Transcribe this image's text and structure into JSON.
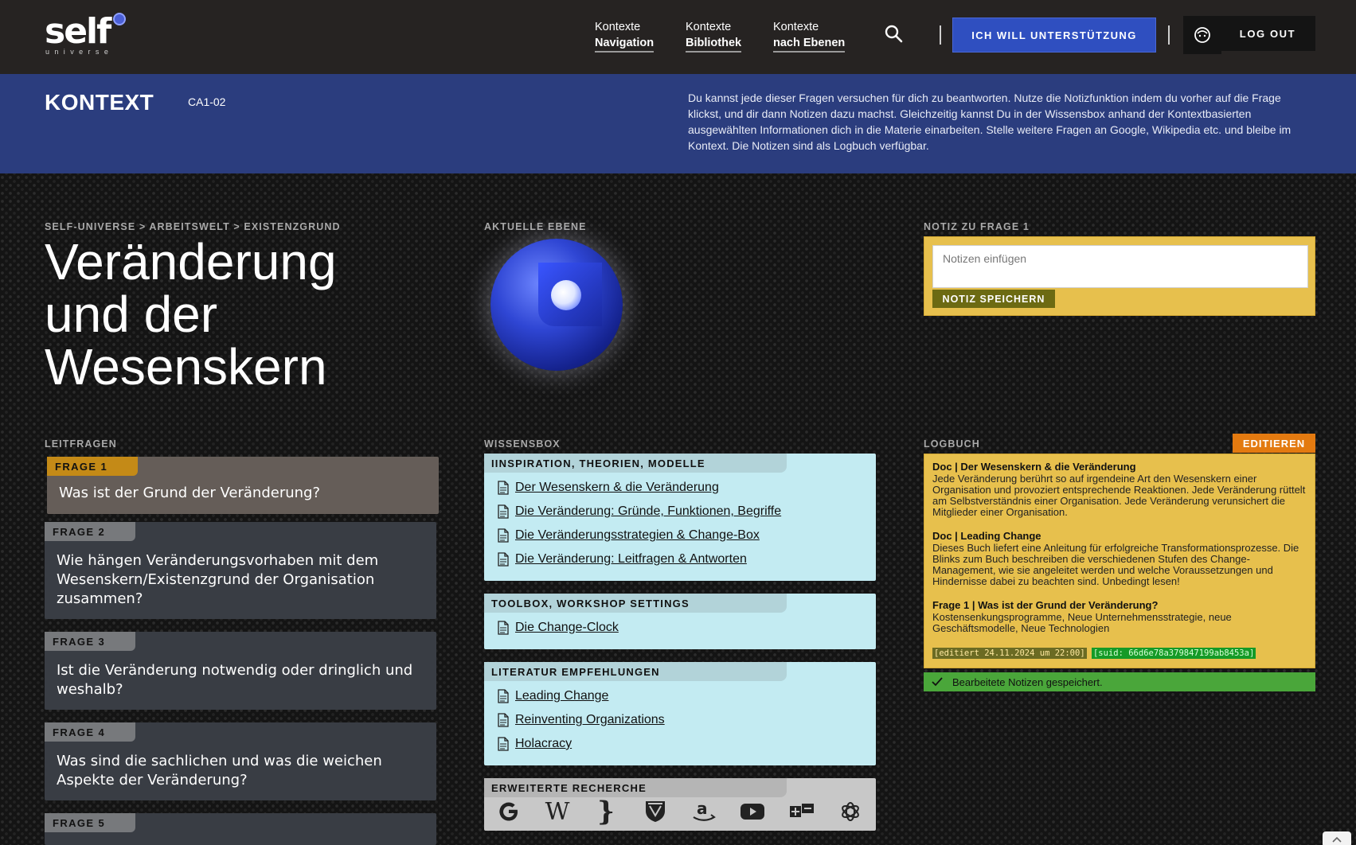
{
  "header": {
    "logo_word": "self",
    "logo_sub": "universe",
    "nav": [
      {
        "line1": "Kontexte",
        "line2": "Navigation"
      },
      {
        "line1": "Kontexte",
        "line2": "Bibliothek"
      },
      {
        "line1": "Kontexte",
        "line2": "nach Ebenen"
      }
    ],
    "support_label": "ICH WILL UNTERSTÜTZUNG",
    "logout_label": "LOG OUT"
  },
  "context": {
    "title": "KONTEXT",
    "code": "CA1-02",
    "description": "Du kannst jede dieser Fragen versuchen für dich zu beantworten. Nutze die Notizfunktion indem du vorher auf die Frage klickst, und dir dann Notizen dazu machst. Gleichzeitig kannst Du in der Wissensbox anhand der Kontextbasierten ausgewählten Informationen dich in die Materie einarbeiten. Stelle weitere Fragen an Google, Wikipedia etc. und bleibe im Kontext. Die Notizen sind als Logbuch verfügbar."
  },
  "breadcrumb": "SELF-UNIVERSE > ARBEITSWELT > EXISTENZGRUND",
  "title_lines": [
    "Veränderung",
    "und der",
    "Wesenskern"
  ],
  "level": {
    "label": "AKTUELLE EBENE"
  },
  "note": {
    "label": "NOTIZ ZU FRAGE 1",
    "placeholder": "Notizen einfügen",
    "save_label": "NOTIZ SPEICHERN"
  },
  "questions": {
    "label": "LEITFRAGEN",
    "items": [
      {
        "tag": "FRAGE 1",
        "text": "Was ist der Grund der Veränderung?"
      },
      {
        "tag": "FRAGE 2",
        "text": "Wie hängen Veränderungsvorhaben mit dem Wesenskern/Existenzgrund der Organisation zusammen?"
      },
      {
        "tag": "FRAGE 3",
        "text": "Ist die Veränderung notwendig oder dringlich und weshalb?"
      },
      {
        "tag": "FRAGE 4",
        "text": "Was sind die sachlichen und was die weichen Aspekte der Veränderung?"
      },
      {
        "tag": "FRAGE 5",
        "text": ""
      }
    ]
  },
  "wissensbox": {
    "label": "WISSENSBOX",
    "sections": [
      {
        "title": "IINSPIRATION, THEORIEN, MODELLE",
        "links": [
          "Der Wesenskern & die Veränderung",
          "Die Veränderung: Gründe, Funktionen, Begriffe",
          "Die Veränderungsstrategien & Change-Box",
          "Die Veränderung: Leitfragen & Antworten"
        ]
      },
      {
        "title": "TOOLBOX, WORKSHOP SETTINGS",
        "links": [
          "Die Change-Clock"
        ]
      },
      {
        "title": "LITERATUR EMPFEHLUNGEN",
        "links": [
          "Leading Change",
          "Reinventing Organizations",
          "Holacracy"
        ]
      }
    ],
    "research_title": "ERWEITERTE RECHERCHE",
    "research_icons": [
      "google-icon",
      "wikipedia-icon",
      "code-brace-icon",
      "university-crest-icon",
      "amazon-icon",
      "youtube-icon",
      "plus-minus-chat-icon",
      "openai-icon"
    ]
  },
  "logbuch": {
    "label": "LOGBUCH",
    "edit_label": "EDITIEREN",
    "entries": [
      {
        "title": "Doc | Der Wesenskern & die Veränderung",
        "text": "Jede Veränderung berührt so auf irgendeine Art den Wesenskern einer Organisation und provoziert entsprechende Reaktionen. Jede Veränderung rüttelt am Selbstverständnis einer Organisation. Jede Veränderung verunsichert die Mitglieder einer Organisation."
      },
      {
        "title": "Doc | Leading Change",
        "text": "Dieses Buch liefert eine Anleitung für erfolgreiche Transformationsprozesse. Die Blinks zum Buch beschreiben die verschiedenen Stufen des Change-Management, wie sie angeleitet werden und welche Voraussetzungen und Hindernisse dabei zu beachten sind. Unbedingt lesen!"
      },
      {
        "title": "Frage 1 | Was ist der Grund der Veränderung?",
        "text": "Kostensenkungsprogramme, Neue Unternehmensstrategie, neue Geschäftsmodelle, Neue Technologien"
      }
    ],
    "meta_edited": "[editiert 24.11.2024 um 22:00]",
    "meta_suid": "[suid: 66d6e78a379847199ab8453a]",
    "status": "Bearbeitete Notizen gespeichert."
  },
  "colors": {
    "header_bg": "#262322",
    "context_bg": "#2b3d7e",
    "accent_blue": "#2f4fc0",
    "note_yellow": "#e7c04d",
    "active_tag": "#c48a17",
    "wissensbox_bg": "#c3ebf2",
    "edit_orange": "#e37a10",
    "status_green": "#4aa63a"
  }
}
